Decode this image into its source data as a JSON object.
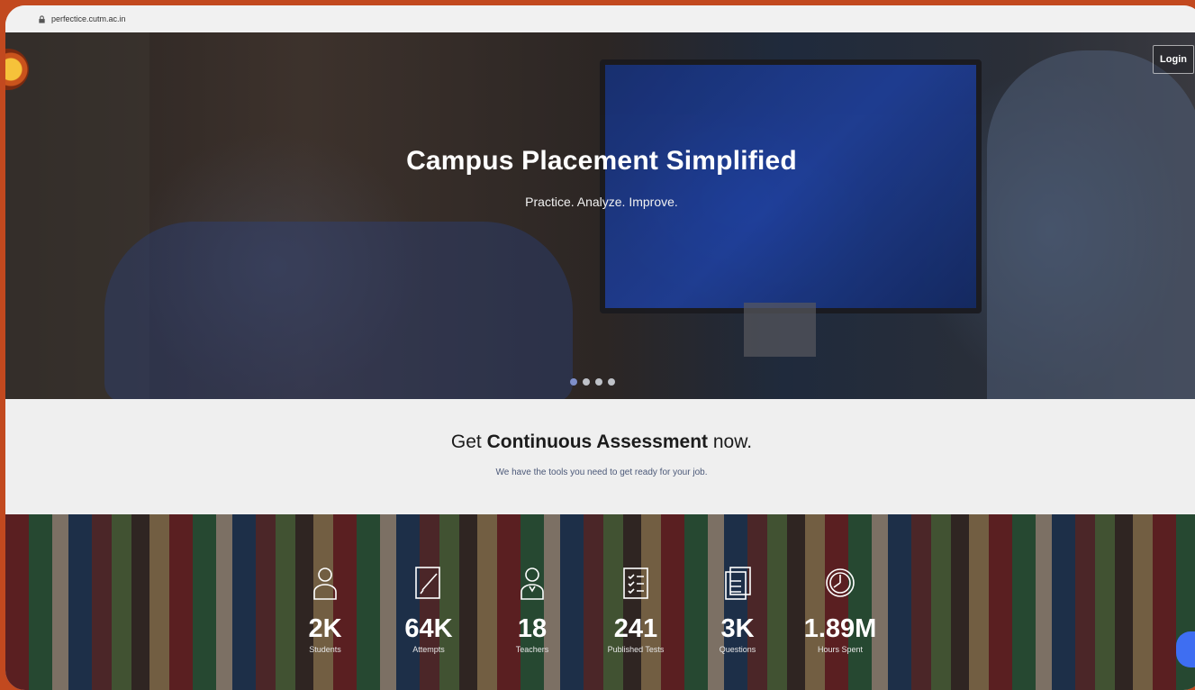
{
  "browser": {
    "url": "perfectice.cutm.ac.in"
  },
  "header": {
    "login_label": "Login"
  },
  "hero": {
    "title": "Campus Placement Simplified",
    "subtitle": "Practice. Analyze. Improve.",
    "slides": 4,
    "active_slide": 1
  },
  "assessment": {
    "title_prefix": "Get ",
    "title_bold": "Continuous Assessment",
    "title_suffix": " now.",
    "subtitle": "We have the tools you need to get ready for your job."
  },
  "stats": [
    {
      "icon": "user-icon",
      "value": "2K",
      "label": "Students"
    },
    {
      "icon": "pencil-doc-icon",
      "value": "64K",
      "label": "Attempts"
    },
    {
      "icon": "teacher-icon",
      "value": "18",
      "label": "Teachers"
    },
    {
      "icon": "checklist-icon",
      "value": "241",
      "label": "Published Tests"
    },
    {
      "icon": "documents-icon",
      "value": "3K",
      "label": "Questions"
    },
    {
      "icon": "clock-icon",
      "value": "1.89M",
      "label": "Hours Spent"
    }
  ],
  "colors": {
    "accent": "#c2491f",
    "dot_active": "#7f8fc9",
    "chat_button": "#3e6ef2"
  }
}
